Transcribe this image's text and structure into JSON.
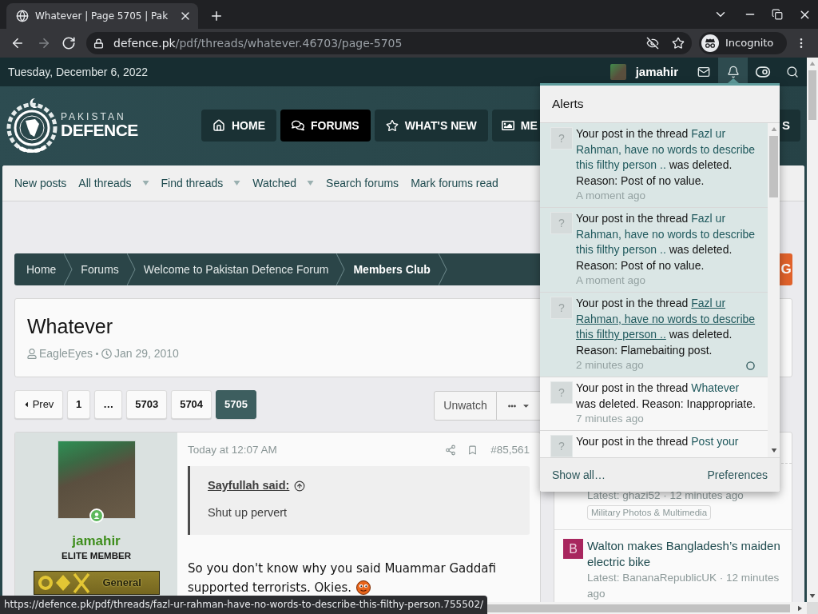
{
  "browser": {
    "tab": {
      "title": "Whatever | Page 5705 | Pak"
    },
    "nav_buttons": [
      {
        "kind": "back",
        "disabled": false
      },
      {
        "kind": "forward",
        "disabled": true
      },
      {
        "kind": "reload",
        "disabled": false
      }
    ],
    "address": {
      "domain": "defence.pk",
      "path": "/pdf/threads/whatever.46703/page-5705"
    },
    "profile": {
      "label": "Incognito"
    }
  },
  "top_bar": {
    "date": "Tuesday, December 6, 2022",
    "username": "jamahir",
    "icons": [
      {
        "kind": "mail",
        "selected": false
      },
      {
        "kind": "bell",
        "selected": true
      },
      {
        "kind": "toggle",
        "selected": false
      },
      {
        "kind": "search",
        "selected": false
      }
    ]
  },
  "logo": {
    "line_1": "PAKISTAN",
    "line_2": "DEFENCE"
  },
  "nav_tabs": [
    {
      "label": "HOME",
      "selected": false
    },
    {
      "label": "FORUMS",
      "selected": true
    },
    {
      "label": "WHAT'S NEW",
      "selected": false
    },
    {
      "label": "ME",
      "selected": false
    }
  ],
  "nav_tab_clipped": {
    "label": "S"
  },
  "sub_nav": [
    {
      "label": "New posts",
      "dropdown": false
    },
    {
      "label": "All threads",
      "dropdown": true
    },
    {
      "label": "Find threads",
      "dropdown": true
    },
    {
      "label": "Watched",
      "dropdown": true
    },
    {
      "label": "Search forums",
      "dropdown": false
    },
    {
      "label": "Mark forums read",
      "dropdown": false
    }
  ],
  "breadcrumb": [
    {
      "label": "Home",
      "current": false
    },
    {
      "label": "Forums",
      "current": false
    },
    {
      "label": "Welcome to Pakistan Defence Forum",
      "current": false
    },
    {
      "label": "Members Club",
      "current": true
    }
  ],
  "corner_button": {
    "label": "G"
  },
  "thread": {
    "title": "Whatever",
    "author": "EagleEyes",
    "date": "Jan 29, 2010"
  },
  "pagination": {
    "prev": "Prev",
    "pages": [
      {
        "label": "1",
        "selected": false
      },
      {
        "label": "…",
        "selected": false
      },
      {
        "label": "5703",
        "selected": false
      },
      {
        "label": "5704",
        "selected": false
      },
      {
        "label": "5705",
        "selected": true
      }
    ]
  },
  "thread_actions": {
    "watch": "Unwatch"
  },
  "post": {
    "user": {
      "name": "jamahir",
      "title": "ELITE MEMBER",
      "rank": "General",
      "online": true
    },
    "date": "Today at 12:07 AM",
    "number": "#85,561",
    "quote": {
      "author": "Sayfullah said:",
      "text": "Shut up pervert"
    },
    "body": "So you don't know why you said Muammar Gaddafi supported terrorists. Okies."
  },
  "sidebar": {
    "threads": [
      {
        "meta": "Latest: ghazi52 · 12 minutes ago",
        "tag": "Military Photos & Multimedia"
      },
      {
        "avatar": {
          "letter": "B",
          "color": "#a8265e"
        },
        "title": "Walton makes Bangladesh’s maiden electric bike",
        "meta": "Latest: BananaRepublicUK · 12 minutes ago"
      }
    ]
  },
  "alerts": {
    "title": "Alerts",
    "items": [
      {
        "avatar": "?",
        "prefix": "Your post in the thread",
        "link": "Fazl ur Rahman, have no words to describe this filthy person ..",
        "suffix": "was deleted. Reason: Post of no value.",
        "time": "A moment ago",
        "unread": true,
        "hovered": false
      },
      {
        "avatar": "?",
        "prefix": "Your post in the thread",
        "link": "Fazl ur Rahman, have no words to describe this filthy person ..",
        "suffix": "was deleted. Reason: Post of no value.",
        "time": "A moment ago",
        "unread": true,
        "hovered": false
      },
      {
        "avatar": "?",
        "prefix": "Your post in the thread",
        "link": "Fazl ur Rahman, have no words to describe this filthy person ..",
        "suffix": "was deleted. Reason: Flamebaiting post.",
        "time": "2 minutes ago",
        "unread": true,
        "hovered": true
      },
      {
        "avatar": "?",
        "prefix": "Your post in the thread",
        "link": "Whatever",
        "suffix": "was deleted. Reason: Inappropriate.",
        "time": "7 minutes ago",
        "unread": false,
        "hovered": false
      },
      {
        "avatar": "?",
        "prefix": "Your post in the thread",
        "link": "Post your",
        "unread": false,
        "hovered": false
      }
    ],
    "show_all": "Show all…",
    "preferences": "Preferences"
  },
  "status_url": "https://defence.pk/pdf/threads/fazl-ur-rahman-have-no-words-to-describe-this-filthy-person.755502/"
}
